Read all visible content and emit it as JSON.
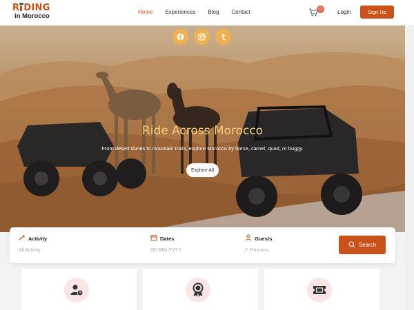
{
  "brand": {
    "logo_top_1": "R",
    "logo_top_2": "DING",
    "logo_bottom": "in Morocco"
  },
  "nav": {
    "items": [
      "Home",
      "Experiences",
      "Blog",
      "Contact"
    ],
    "active": "Home"
  },
  "header": {
    "cart_count": "0",
    "login_label": "Login",
    "signup_label": "Sign Up"
  },
  "social": [
    "facebook-icon",
    "instagram-icon",
    "tumblr-icon"
  ],
  "hero": {
    "title": "Ride Across Morocco",
    "subtitle": "From desert dunes to mountain trails, explore Morocco by horse, camel, quad, or buggy.",
    "cta_label": "Explore All"
  },
  "search": {
    "activity_label": "Activity",
    "activity_value": "All Activity",
    "dates_label": "Dates",
    "dates_placeholder": "DD-MM-YYYY",
    "guests_label": "Guests",
    "guests_count": "2",
    "guests_unit": "Persons",
    "button_label": "Search"
  },
  "cards": [
    "user-clock-icon",
    "award-icon",
    "ticket-icon"
  ],
  "colors": {
    "accent": "#c9521a",
    "social": "#f0b050",
    "hero_title": "#f5cf7a",
    "card_icon_bg": "#fbe4e4"
  }
}
